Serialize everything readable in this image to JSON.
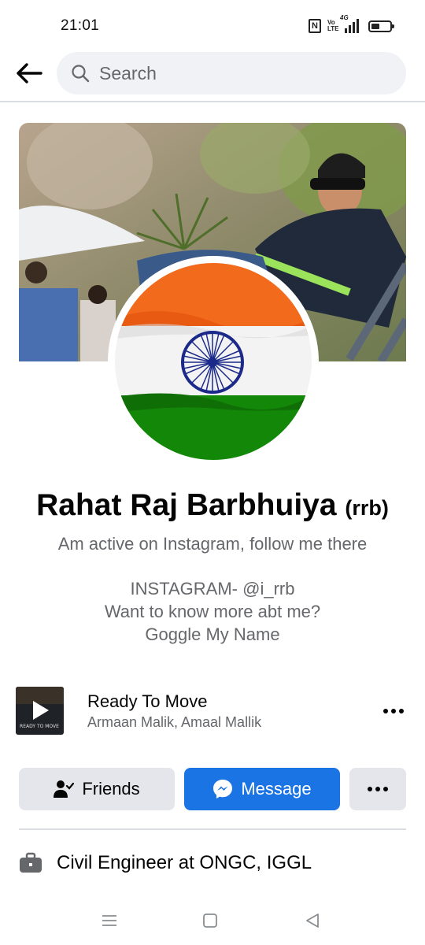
{
  "status_bar": {
    "time": "21:01",
    "network": "4G",
    "icons": [
      "nfc-icon",
      "volte-icon",
      "signal-icon",
      "battery-icon"
    ]
  },
  "search": {
    "placeholder": "Search",
    "back_icon": "arrow-left-icon",
    "search_icon": "magnifier-icon"
  },
  "profile": {
    "name": "Rahat Raj Barbhuiya",
    "nickname": "(rrb)",
    "bio": [
      "Am active on Instagram, follow me there",
      "INSTAGRAM- @i_rrb",
      "Want to know more abt me?",
      "Goggle My Name"
    ]
  },
  "music": {
    "title": "Ready To Move",
    "artist": "Armaan Malik, Amaal Mallik",
    "album_art_text": "READY TO MOVE"
  },
  "actions": {
    "friends_label": "Friends",
    "message_label": "Message",
    "more_icon": "more-horizontal-icon"
  },
  "details": {
    "work": "Civil Engineer at ONGC, IGGL",
    "work_icon": "briefcase-icon"
  },
  "system_nav": {
    "icons": [
      "menu-icon",
      "home-square-icon",
      "back-triangle-icon"
    ]
  },
  "colors": {
    "primary": "#1b74e4",
    "button_gray": "#e4e6eb",
    "search_bg": "#f0f2f5",
    "secondary_text": "#65676b",
    "saffron": "#f26b1d",
    "india_green": "#138808",
    "chakra_blue": "#1b2a8a"
  }
}
